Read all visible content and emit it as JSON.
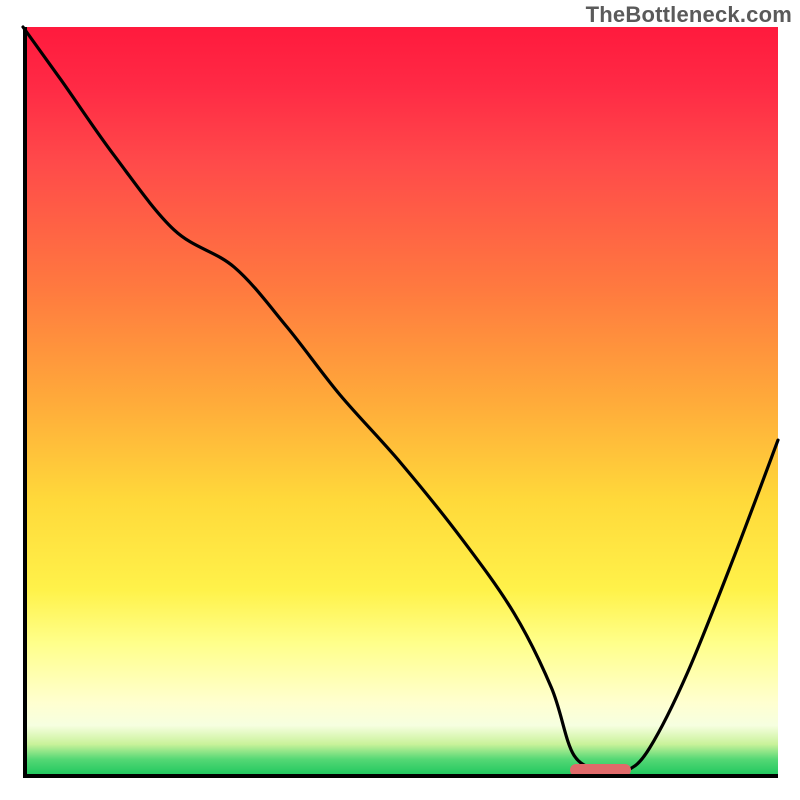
{
  "watermark": "TheBottleneck.com",
  "marker": {
    "color": "#e06a6a",
    "x_start_pct": 72.5,
    "x_end_pct": 80.5,
    "y_pct": 99.0
  },
  "chart_data": {
    "type": "line",
    "title": "",
    "xlabel": "",
    "ylabel": "",
    "xlim": [
      0,
      100
    ],
    "ylim": [
      0,
      100
    ],
    "grid": false,
    "legend": false,
    "background_meaning": "vertical color gradient = bottleneck severity (top red=high, bottom green=low)",
    "series": [
      {
        "name": "bottleneck-curve",
        "x": [
          0,
          5,
          12,
          20,
          28,
          35,
          42,
          50,
          58,
          65,
          70,
          73,
          77,
          80,
          83,
          88,
          94,
          100
        ],
        "values": [
          100,
          93,
          83,
          73,
          68,
          60,
          51,
          42,
          32,
          22,
          12,
          3,
          1,
          1,
          4,
          14,
          29,
          45
        ]
      }
    ],
    "annotations": [
      {
        "type": "marker-bar",
        "desc": "optimal range indicator at valley bottom",
        "x_range_pct": [
          72.5,
          80.5
        ],
        "y_pct": 1.0,
        "color": "#e06a6a"
      }
    ]
  }
}
